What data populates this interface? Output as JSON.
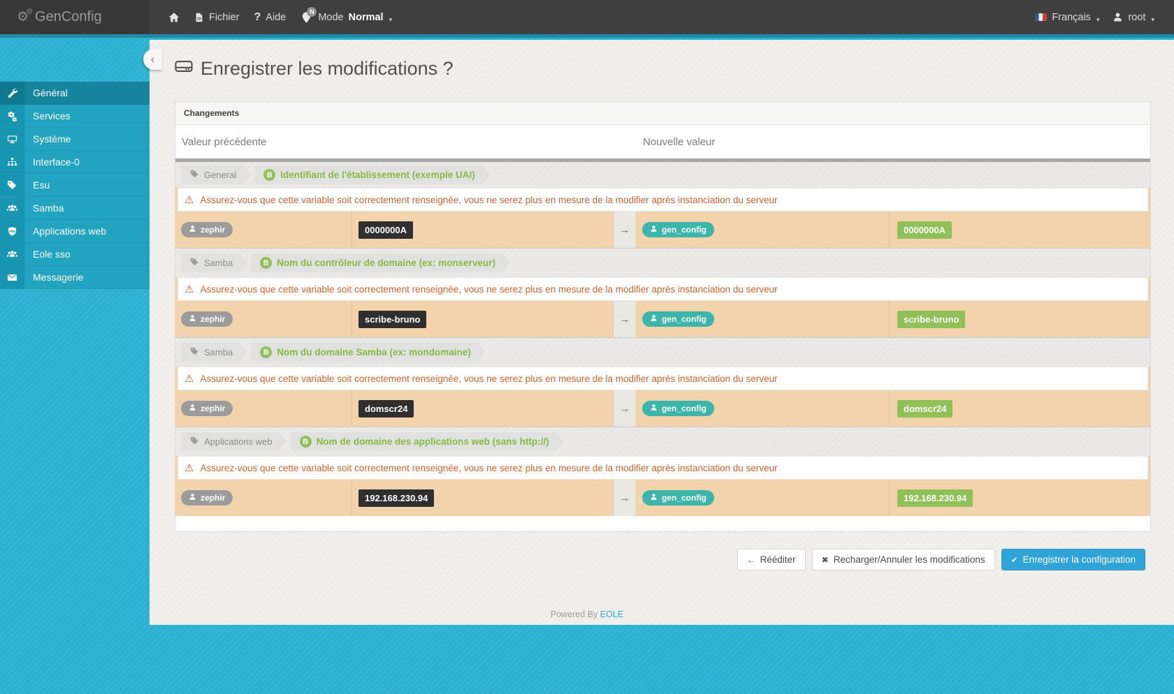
{
  "navbar": {
    "brand": "GenConfig",
    "menu": {
      "file_label": "Fichier",
      "help_label": "Aide",
      "help_glyph": "?",
      "mode_label": "Mode",
      "mode_value": "Normal",
      "mode_badge": "N"
    },
    "right": {
      "language": "Français",
      "user": "root"
    }
  },
  "sidebar": {
    "active_index": 0,
    "items": [
      {
        "id": "general",
        "label": "Général",
        "icon": "wrench-icon"
      },
      {
        "id": "services",
        "label": "Services",
        "icon": "cogs-icon"
      },
      {
        "id": "systeme",
        "label": "Système",
        "icon": "desktop-icon"
      },
      {
        "id": "interface-0",
        "label": "Interface-0",
        "icon": "sitemap-icon"
      },
      {
        "id": "esu",
        "label": "Esu",
        "icon": "tag-icon"
      },
      {
        "id": "samba",
        "label": "Samba",
        "icon": "users-icon"
      },
      {
        "id": "applications-web",
        "label": "Applications web",
        "icon": "php-icon"
      },
      {
        "id": "eole-sso",
        "label": "Eole sso",
        "icon": "users-icon"
      },
      {
        "id": "messagerie",
        "label": "Messagerie",
        "icon": "envelope-icon"
      }
    ]
  },
  "header": {
    "title": "Enregistrer les modifications ?"
  },
  "panel": {
    "title": "Changements",
    "col_previous": "Valeur précédente",
    "col_new": "Nouvelle valeur",
    "warning": "Assurez-vous que cette variable soit correctement renseignée, vous ne serez plus en mesure de la modifier après instanciation du serveur",
    "old_source": "zephir",
    "new_source": "gen_config",
    "groups": [
      {
        "category": "General",
        "badge": "B",
        "label": "Identifiant de l'établissement (exemple UAI)",
        "old": "0000000A",
        "new": "0000000A"
      },
      {
        "category": "Samba",
        "badge": "B",
        "label": "Nom du contrôleur de domaine (ex: monserveur)",
        "old": "scribe-bruno",
        "new": "scribe-bruno"
      },
      {
        "category": "Samba",
        "badge": "B",
        "label": "Nom du domaine Samba (ex: mondomaine)",
        "old": "domscr24",
        "new": "domscr24"
      },
      {
        "category": "Applications web",
        "badge": "B",
        "label": "Nom de domaine des applications web (sans http://)",
        "old": "192.168.230.94",
        "new": "192.168.230.94"
      }
    ]
  },
  "actions": {
    "reedit": "Rééditer",
    "reload": "Recharger/Annuler les modifications",
    "save": "Enregistrer la configuration"
  },
  "footer": {
    "powered": "Powered By",
    "brand": "EOLE"
  },
  "colors": {
    "page": "#2ab1d2",
    "navbar": "#3f3f3f",
    "content": "#f1f0ec",
    "accent": "#2fa4d8",
    "old_source": "#9b9b9b",
    "new_source": "#3cb6ab",
    "old_value_bg": "#2f2f2f",
    "new_value_bg": "#8fc158",
    "row_bg": "#f3d3ac",
    "warning": "#d2622d",
    "green_label": "#83ba42"
  }
}
